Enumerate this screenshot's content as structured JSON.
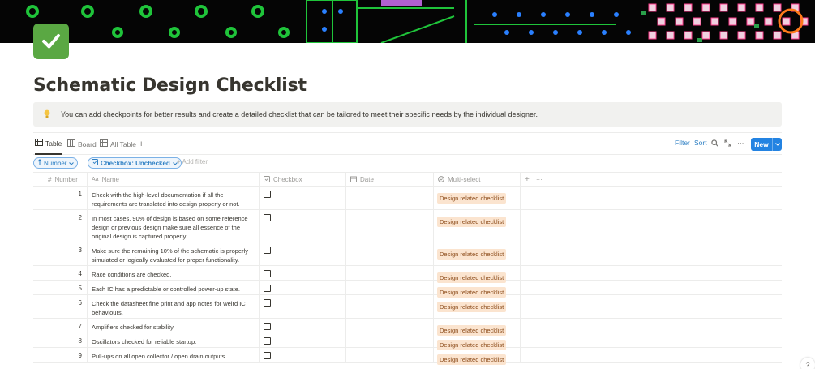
{
  "page": {
    "title": "Schematic Design Checklist",
    "callout": "You can add checkpoints for better results and create a detailed checklist that can be tailored to meet their specific needs by the individual designer."
  },
  "views": {
    "tabs": [
      {
        "label": "Table",
        "icon": "table-icon",
        "active": true
      },
      {
        "label": "Board",
        "icon": "board-icon",
        "active": false
      },
      {
        "label": "All Table",
        "icon": "table-icon",
        "active": false
      }
    ],
    "add_view": "+",
    "toolbar": {
      "filter": "Filter",
      "sort": "Sort",
      "more": "···",
      "new": "New"
    }
  },
  "filters": {
    "sort_pill": "Number",
    "filter_pill": "Checkbox: Unchecked",
    "add_filter": "Add filter"
  },
  "table": {
    "columns": [
      {
        "label": "Number",
        "icon": "hash-icon"
      },
      {
        "label": "Name",
        "icon": "text-icon"
      },
      {
        "label": "Checkbox",
        "icon": "checkbox-icon"
      },
      {
        "label": "Date",
        "icon": "calendar-icon"
      },
      {
        "label": "Multi-select",
        "icon": "multiselect-icon"
      }
    ],
    "add_column": "+",
    "more": "···",
    "rows": [
      {
        "number": "1",
        "name": "Check with the high-level documentation if all the requirements are translated into design properly or not.",
        "checked": false,
        "tag": "Design related checklist"
      },
      {
        "number": "2",
        "name": "In most cases, 90% of design is based on some reference design or previous design make sure all essence of the original design is captured properly.",
        "checked": false,
        "tag": "Design related checklist"
      },
      {
        "number": "3",
        "name": "Make sure the remaining 10% of the schematic is properly simulated or logically evaluated for proper functionality.",
        "checked": false,
        "tag": "Design related checklist"
      },
      {
        "number": "4",
        "name": "Race conditions are checked.",
        "checked": false,
        "tag": "Design related checklist"
      },
      {
        "number": "5",
        "name": "Each IC has a predictable or controlled power-up state.",
        "checked": false,
        "tag": "Design related checklist"
      },
      {
        "number": "6",
        "name": "Check the datasheet fine print and app notes for weird IC behaviours.",
        "checked": false,
        "tag": "Design related checklist"
      },
      {
        "number": "7",
        "name": "Amplifiers checked for stability.",
        "checked": false,
        "tag": "Design related checklist"
      },
      {
        "number": "8",
        "name": "Oscillators checked for reliable startup.",
        "checked": false,
        "tag": "Design related checklist"
      },
      {
        "number": "9",
        "name": "Pull-ups on all open collector / open drain outputs.",
        "checked": false,
        "tag": "Design related checklist"
      }
    ]
  },
  "help": "?",
  "colors": {
    "accent": "#2383e2",
    "tag_bg": "#fbe4cf",
    "tag_text": "#8b4a18",
    "icon_green": "#5aa843"
  }
}
